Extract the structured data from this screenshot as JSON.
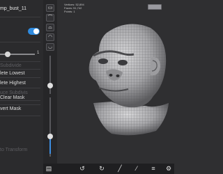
{
  "project": {
    "title": "mp_bust_11"
  },
  "slider": {
    "value_label": "1"
  },
  "menu": {
    "items": [
      {
        "label": "Subdivide",
        "enabled": false
      },
      {
        "label": "lete Lowest",
        "enabled": true
      },
      {
        "label": "lete Highest",
        "enabled": true
      },
      {
        "label": "uce Subdivis",
        "enabled": false
      },
      {
        "label": "Clear Mask",
        "enabled": true
      },
      {
        "label": "vert Mask",
        "enabled": true
      },
      {
        "label": "to Transform",
        "enabled": false
      }
    ]
  },
  "stats": {
    "line1": "Vertices: 52,894",
    "line2": "Faces: 51,742",
    "line3": "Points: 1"
  },
  "tools": [
    "plane-icon",
    "curve-icon",
    "arch-icon",
    "loop-icon",
    "ring-icon"
  ],
  "bottom_bar": {
    "icons": [
      "undo-icon",
      "redo-icon",
      "rotate-icon",
      "brush-icon",
      "layers-icon",
      "settings-icon"
    ]
  },
  "colors": {
    "accent": "#2e8be0",
    "panel": "#2b2b2d",
    "canvas": "#2f2f31"
  }
}
